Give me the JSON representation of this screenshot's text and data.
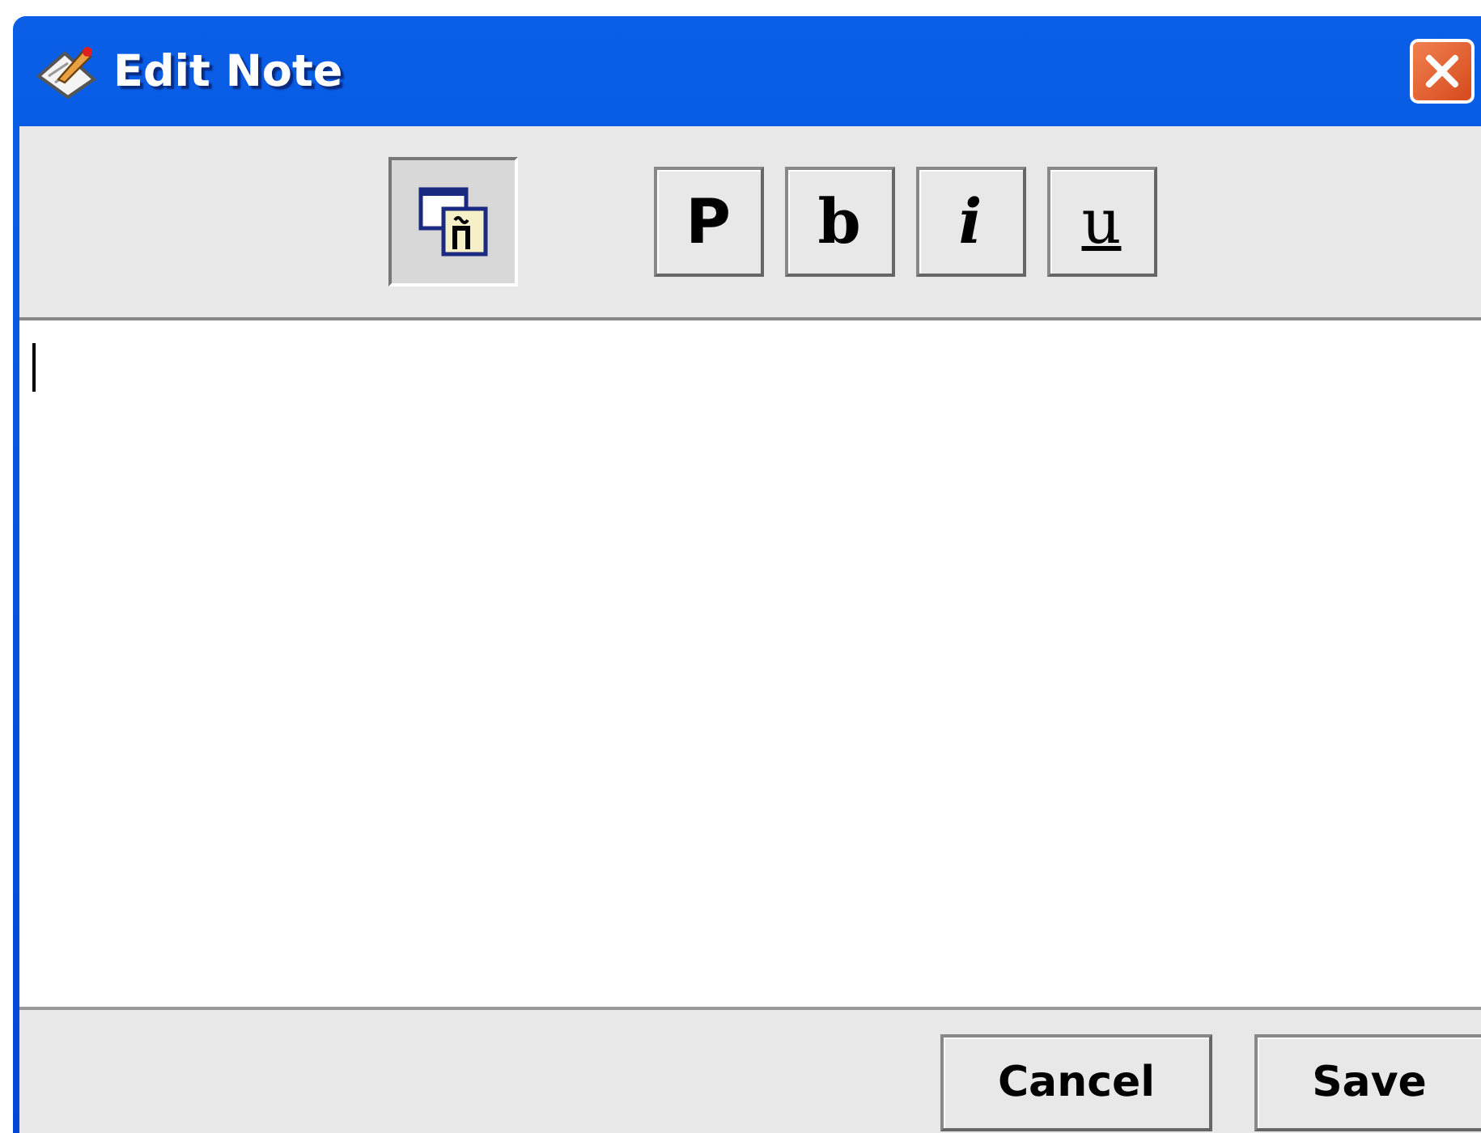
{
  "window": {
    "title": "Edit Note"
  },
  "toolbar": {
    "special_characters": {
      "pressed": true
    },
    "format_buttons": [
      {
        "label": "P",
        "kind": "plain",
        "pressed": false
      },
      {
        "label": "b",
        "kind": "bold",
        "pressed": false
      },
      {
        "label": "i",
        "kind": "italic",
        "pressed": false
      },
      {
        "label": "u",
        "kind": "underline",
        "pressed": false
      }
    ]
  },
  "editor": {
    "focused": true
  },
  "buttons": [
    {
      "label": "Cancel"
    },
    {
      "label": "Save"
    }
  ]
}
